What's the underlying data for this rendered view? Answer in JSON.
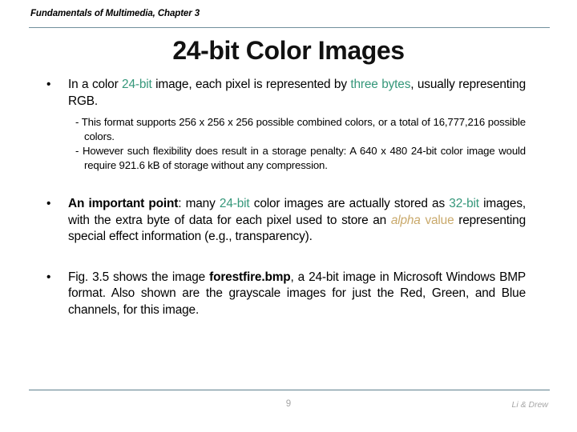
{
  "slide": {
    "header": "Fundamentals of Multimedia, Chapter 3",
    "title": "24-bit Color Images",
    "bullet_glyph": "•",
    "accent_colors": {
      "rule": "#718f9c",
      "footer_rule": "#5d7f8c",
      "highlight_green": "#35977a",
      "highlight_tan": "#c9a96b",
      "footer_text": "#a6a6a6"
    },
    "bullets": [
      {
        "id": "bullet-color-24bit",
        "segments": [
          {
            "text": "In a color ",
            "style": "normal"
          },
          {
            "text": "24-bit",
            "style": "green"
          },
          {
            "text": " image, each pixel is represented by ",
            "style": "normal"
          },
          {
            "text": "three bytes",
            "style": "green"
          },
          {
            "text": ", usually representing RGB.",
            "style": "normal"
          }
        ],
        "subbullets": [
          {
            "id": "sub-combined-colors",
            "segments": [
              {
                "text": "- This format supports 256 x 256 x 256 possible combined colors, or a total of 16,777,216 possible colors.",
                "style": "normal"
              }
            ]
          },
          {
            "id": "sub-storage-penalty",
            "segments": [
              {
                "text": "- However such flexibility does result in a storage penalty: A 640 x 480 24-bit color image would require 921.6 kB of storage without any compression.",
                "style": "normal"
              }
            ]
          }
        ]
      },
      {
        "id": "bullet-important-point",
        "segments": [
          {
            "text": "An important point",
            "style": "bold"
          },
          {
            "text": ": many ",
            "style": "normal"
          },
          {
            "text": "24-bit",
            "style": "green"
          },
          {
            "text": " color images are actually stored as ",
            "style": "normal"
          },
          {
            "text": "32-bit",
            "style": "green"
          },
          {
            "text": " images, with the extra byte of data for each pixel used to store an ",
            "style": "normal"
          },
          {
            "text": "alpha",
            "style": "tan-italic"
          },
          {
            "text": " value",
            "style": "tan"
          },
          {
            "text": " representing special effect information (e.g., transparency).",
            "style": "normal"
          }
        ],
        "subbullets": []
      },
      {
        "id": "bullet-forestfire",
        "segments": [
          {
            "text": "Fig. 3.5 shows the image ",
            "style": "normal"
          },
          {
            "text": "forestfire.bmp",
            "style": "bold"
          },
          {
            "text": ", a 24-bit image in Microsoft Windows BMP format. Also shown are the grayscale images for just the Red, Green, and Blue channels, for this image.",
            "style": "normal"
          }
        ],
        "subbullets": []
      }
    ],
    "footer": {
      "page_number": "9",
      "author": "Li & Drew"
    }
  }
}
